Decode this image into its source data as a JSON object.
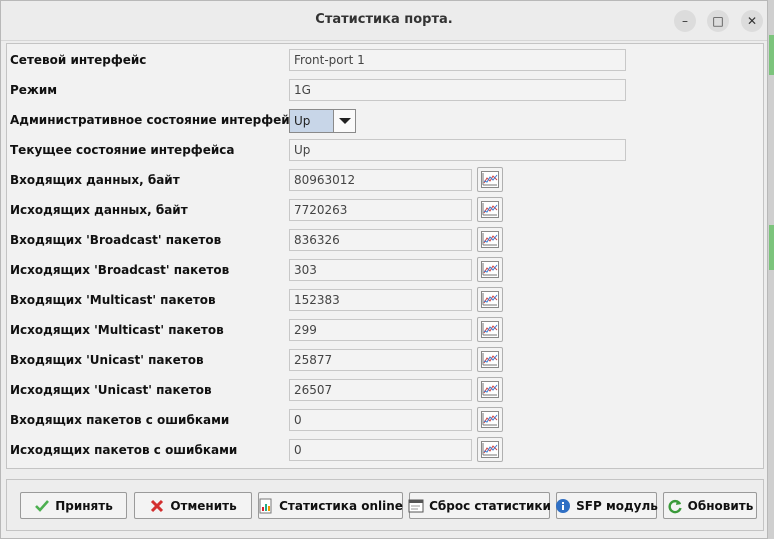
{
  "window": {
    "title": "Статистика порта.",
    "minimize_symbol": "–",
    "maximize_symbol": "□",
    "close_symbol": "✕"
  },
  "fields": {
    "interface": {
      "label": "Сетевой интерфейс",
      "value": "Front-port 1"
    },
    "mode": {
      "label": "Режим",
      "value": "1G"
    },
    "admin_state": {
      "label": "Административное состояние интерфейса",
      "value": "Up"
    },
    "current_state": {
      "label": "Текущее состояние интерфейса",
      "value": "Up"
    }
  },
  "stats": [
    {
      "label": "Входящих данных, байт",
      "value": "80963012"
    },
    {
      "label": "Исходящих данных, байт",
      "value": "7720263"
    },
    {
      "label": "Входящих 'Broadcast' пакетов",
      "value": "836326"
    },
    {
      "label": "Исходящих 'Broadcast' пакетов",
      "value": "303"
    },
    {
      "label": "Входящих 'Multicast' пакетов",
      "value": "152383"
    },
    {
      "label": "Исходящих 'Multicast' пакетов",
      "value": "299"
    },
    {
      "label": "Входящих 'Unicast' пакетов",
      "value": "25877"
    },
    {
      "label": "Исходящих 'Unicast' пакетов",
      "value": "26507"
    },
    {
      "label": "Входящих пакетов с ошибками",
      "value": "0"
    },
    {
      "label": "Исходящих пакетов с ошибками",
      "value": "0"
    }
  ],
  "buttons": {
    "accept": "Принять",
    "cancel": "Отменить",
    "online_stats": "Статистика online",
    "reset_stats": "Сброс статистики",
    "sfp_module": "SFP модуль",
    "refresh": "Обновить"
  },
  "colors": {
    "accept_check": "#4caf50",
    "cancel_x": "#d32f2f",
    "select_highlight": "#c8d6e8"
  },
  "icons": {
    "chart_button": "line-chart-icon",
    "accept": "checkmark-icon",
    "cancel": "red-x-icon",
    "online_stats": "bar-chart-doc-icon",
    "reset_stats": "reset-window-icon",
    "sfp_module": "info-icon",
    "refresh": "refresh-icon"
  }
}
